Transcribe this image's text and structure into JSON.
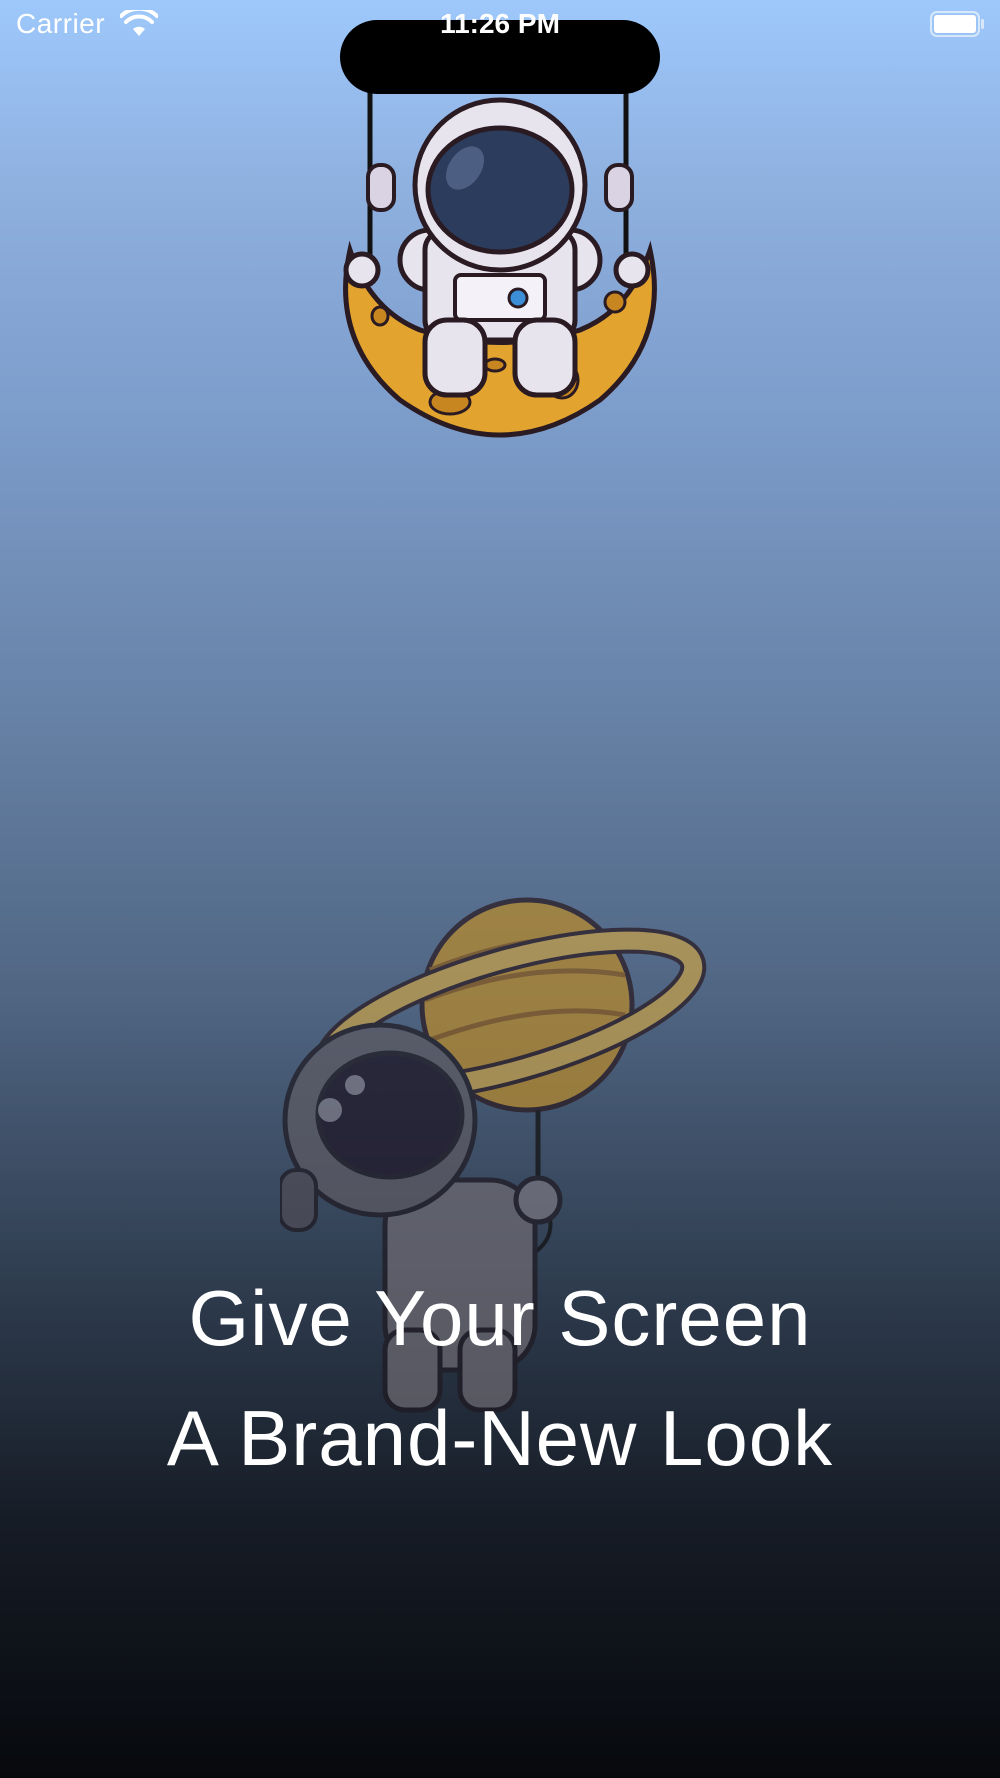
{
  "status_bar": {
    "carrier": "Carrier",
    "time": "11:26 PM",
    "icons": [
      "wifi-icon",
      "battery-icon"
    ]
  },
  "headline": {
    "line1": "Give Your Screen",
    "line2": "A Brand-New Look"
  },
  "illustrations": [
    "astronaut-on-moon-swing",
    "astronaut-with-saturn-balloon"
  ],
  "colors": {
    "background_top": "#9ec8fb",
    "background_bottom": "#07090d",
    "text": "#ffffff",
    "moon": "#e3a32f",
    "saturn": "#b98a2b"
  }
}
